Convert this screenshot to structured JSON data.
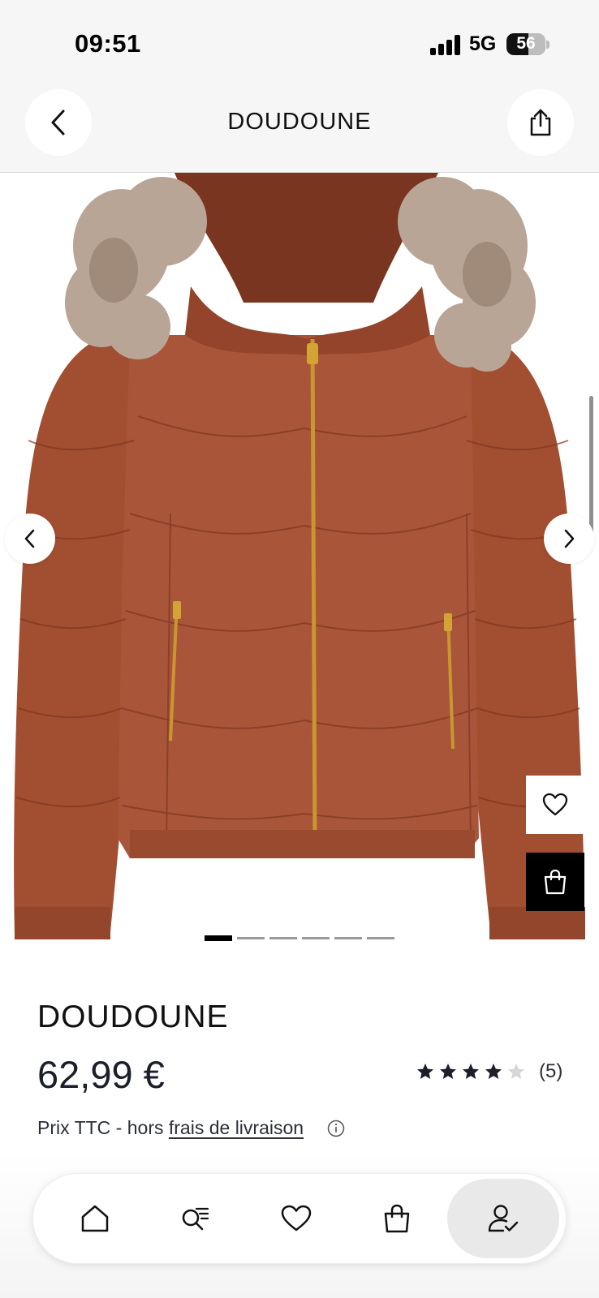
{
  "status_bar": {
    "time": "09:51",
    "network": "5G",
    "battery": "56",
    "battery_level": 0.56
  },
  "header": {
    "title": "DOUDOUNE",
    "back_icon": "chevron-left-icon",
    "share_icon": "share-icon"
  },
  "gallery": {
    "image_count": 6,
    "active_index": 0,
    "product_color": "#a14d2f"
  },
  "product": {
    "title": "DOUDOUNE",
    "price": "62,99 €",
    "rating_value": 4,
    "rating_max": 5,
    "rating_count": "(5)",
    "price_note": "Prix TTC - hors ",
    "shipping_link": "frais de livraison"
  },
  "bottom_nav": {
    "items": [
      {
        "icon": "home-icon"
      },
      {
        "icon": "search-list-icon"
      },
      {
        "icon": "heart-icon"
      },
      {
        "icon": "bag-icon"
      },
      {
        "icon": "account-check-icon",
        "active": true
      }
    ]
  }
}
